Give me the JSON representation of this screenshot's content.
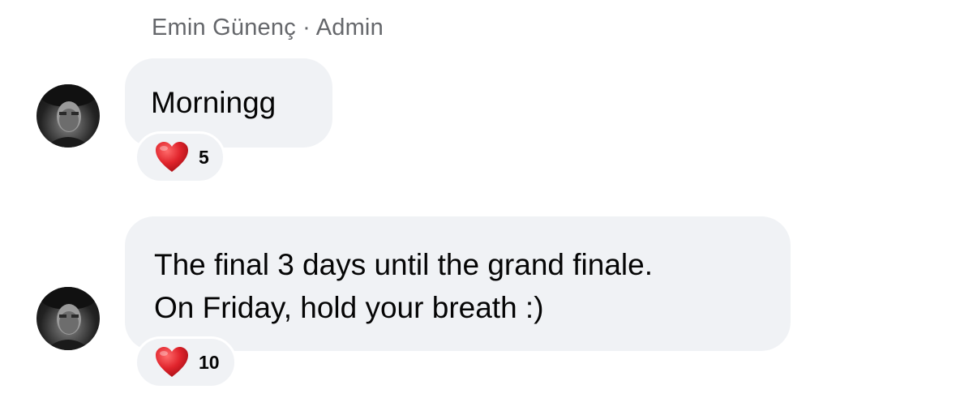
{
  "sender": {
    "name": "Emin Günenç",
    "separator": "·",
    "role": "Admin"
  },
  "messages": [
    {
      "lines": [
        "Morningg"
      ],
      "reaction": {
        "icon": "heart-icon",
        "count": "5"
      }
    },
    {
      "lines": [
        "The final 3 days until the grand finale.",
        "On Friday, hold your breath :)"
      ],
      "reaction": {
        "icon": "heart-icon",
        "count": "10"
      }
    }
  ],
  "colors": {
    "bubble": "#f0f2f5",
    "meta_text": "#65676b",
    "heart": "#e0242c"
  }
}
